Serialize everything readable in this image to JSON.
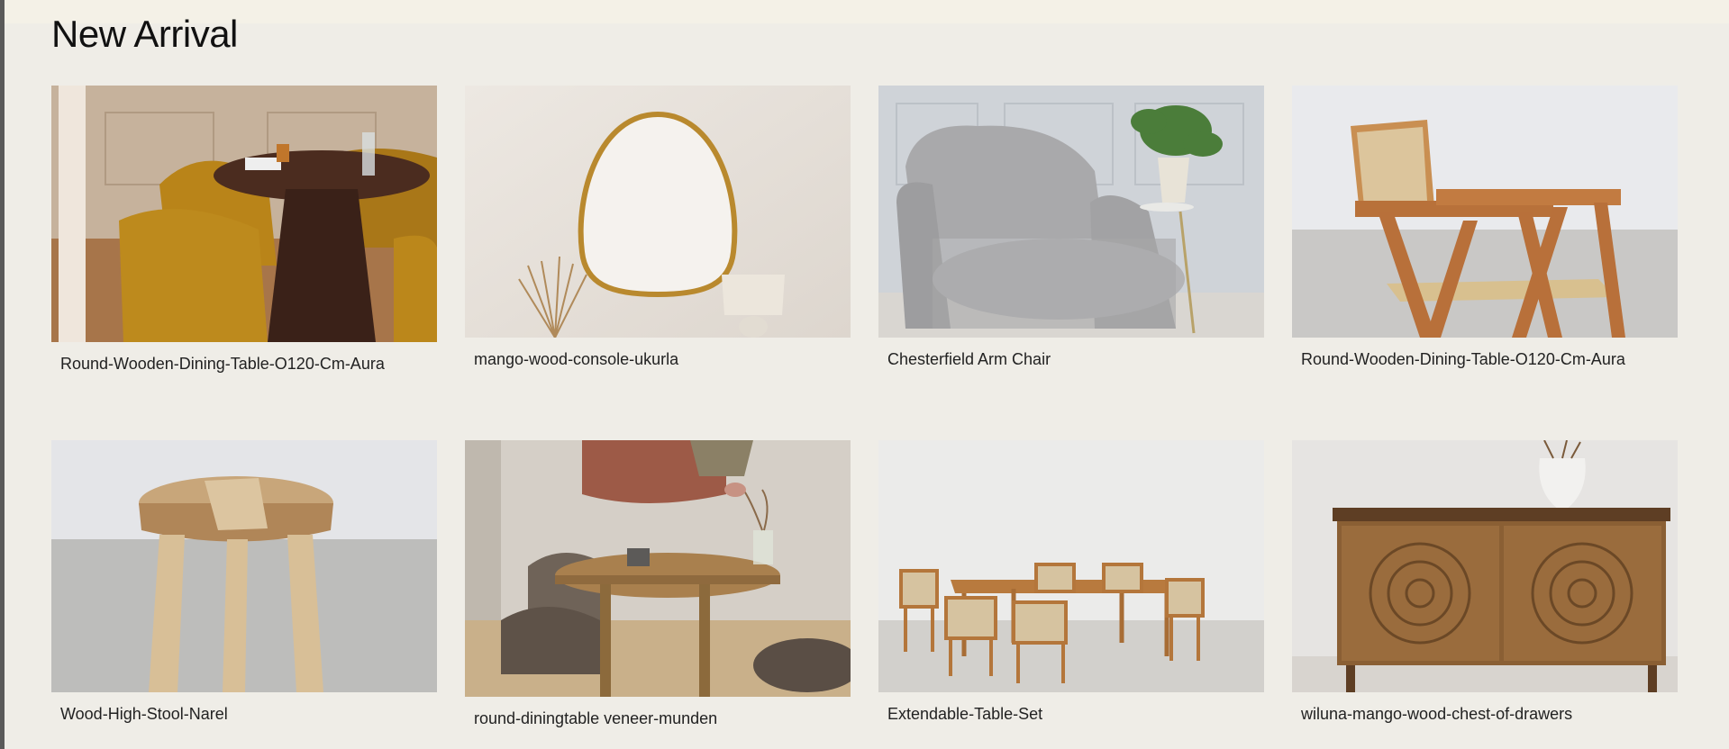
{
  "section": {
    "title": "New Arrival"
  },
  "products": [
    {
      "name": "Round-Wooden-Dining-Table-O120-Cm-Aura",
      "image": "dining-table-velvet-chairs-photo"
    },
    {
      "name": "mango-wood-console-ukurla",
      "image": "gold-arch-mirror-photo"
    },
    {
      "name": "Chesterfield Arm Chair",
      "image": "grey-tufted-armchair-photo"
    },
    {
      "name": "Round-Wooden-Dining-Table-O120-Cm-Aura",
      "image": "wood-rattan-chair-photo"
    },
    {
      "name": "Wood-High-Stool-Narel",
      "image": "wood-high-stool-photo"
    },
    {
      "name": "round-diningtable veneer-munden",
      "image": "round-dining-table-photo"
    },
    {
      "name": "Extendable-Table-Set",
      "image": "extendable-table-set-photo"
    },
    {
      "name": "wiluna-mango-wood-chest-of-drawers",
      "image": "carved-chest-drawers-photo"
    }
  ]
}
